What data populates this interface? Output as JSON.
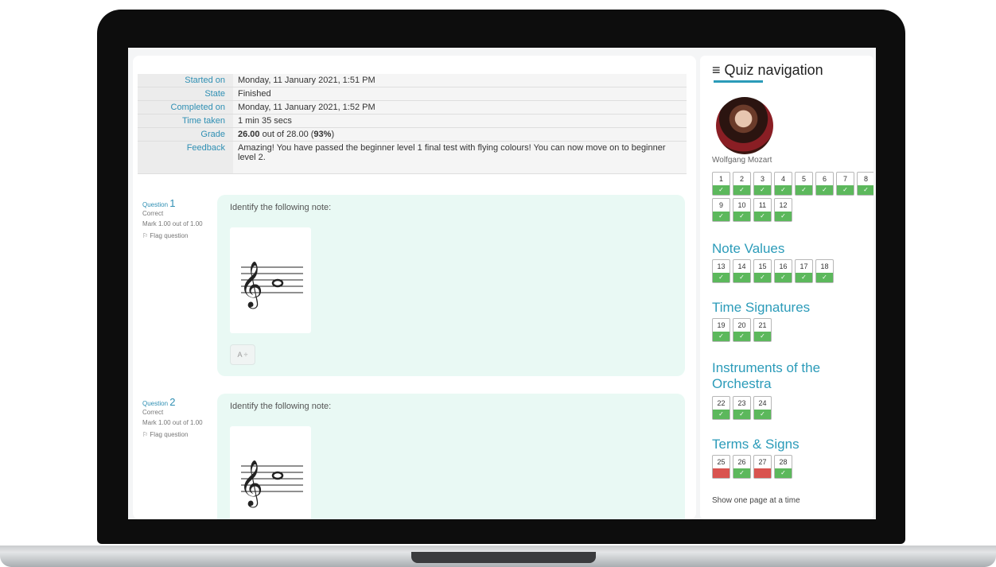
{
  "summary": {
    "rows": [
      {
        "label": "Started on",
        "value": "Monday, 11 January 2021, 1:51 PM"
      },
      {
        "label": "State",
        "value": "Finished"
      },
      {
        "label": "Completed on",
        "value": "Monday, 11 January 2021, 1:52 PM"
      },
      {
        "label": "Time taken",
        "value": "1 min 35 secs"
      }
    ],
    "grade": {
      "label": "Grade",
      "score": "26.00",
      "middle": " out of 28.00 (",
      "percent": "93%",
      "end": ")"
    },
    "feedback": {
      "label": "Feedback",
      "value": "Amazing! You have passed the beginner level 1 final test with flying colours! You can now move on to beginner level 2."
    }
  },
  "questions": [
    {
      "label": "Question",
      "number": "1",
      "status": "Correct",
      "mark": "Mark 1.00 out of 1.00",
      "flag": "Flag question",
      "text": "Identify the following note:",
      "answer": "A ÷"
    },
    {
      "label": "Question",
      "number": "2",
      "status": "Correct",
      "mark": "Mark 1.00 out of 1.00",
      "flag": "Flag question",
      "text": "Identify the following note:"
    }
  ],
  "nav": {
    "title": "Quiz navigation",
    "menu_icon": "≡",
    "user_name": "Wolfgang Mozart",
    "check_glyph": "✓",
    "colors": {
      "correct": "#5cb85c",
      "incorrect": "#d9534f",
      "accent": "#2b9bb9"
    },
    "sections": [
      {
        "title": "",
        "questions": [
          {
            "n": "1",
            "state": "correct"
          },
          {
            "n": "2",
            "state": "correct"
          },
          {
            "n": "3",
            "state": "correct"
          },
          {
            "n": "4",
            "state": "correct"
          },
          {
            "n": "5",
            "state": "correct"
          },
          {
            "n": "6",
            "state": "correct"
          },
          {
            "n": "7",
            "state": "correct"
          },
          {
            "n": "8",
            "state": "correct"
          },
          {
            "n": "9",
            "state": "correct"
          },
          {
            "n": "10",
            "state": "correct"
          },
          {
            "n": "11",
            "state": "correct"
          },
          {
            "n": "12",
            "state": "correct"
          }
        ]
      },
      {
        "title": "Note Values",
        "questions": [
          {
            "n": "13",
            "state": "correct"
          },
          {
            "n": "14",
            "state": "correct"
          },
          {
            "n": "15",
            "state": "correct"
          },
          {
            "n": "16",
            "state": "correct"
          },
          {
            "n": "17",
            "state": "correct"
          },
          {
            "n": "18",
            "state": "correct"
          }
        ]
      },
      {
        "title": "Time Signatures",
        "questions": [
          {
            "n": "19",
            "state": "correct"
          },
          {
            "n": "20",
            "state": "correct"
          },
          {
            "n": "21",
            "state": "correct"
          }
        ]
      },
      {
        "title": "Instruments of the Orchestra",
        "questions": [
          {
            "n": "22",
            "state": "correct"
          },
          {
            "n": "23",
            "state": "correct"
          },
          {
            "n": "24",
            "state": "correct"
          }
        ]
      },
      {
        "title": "Terms & Signs",
        "questions": [
          {
            "n": "25",
            "state": "incorrect"
          },
          {
            "n": "26",
            "state": "correct"
          },
          {
            "n": "27",
            "state": "incorrect"
          },
          {
            "n": "28",
            "state": "correct"
          }
        ]
      }
    ],
    "show_one_page": "Show one page at a time"
  }
}
